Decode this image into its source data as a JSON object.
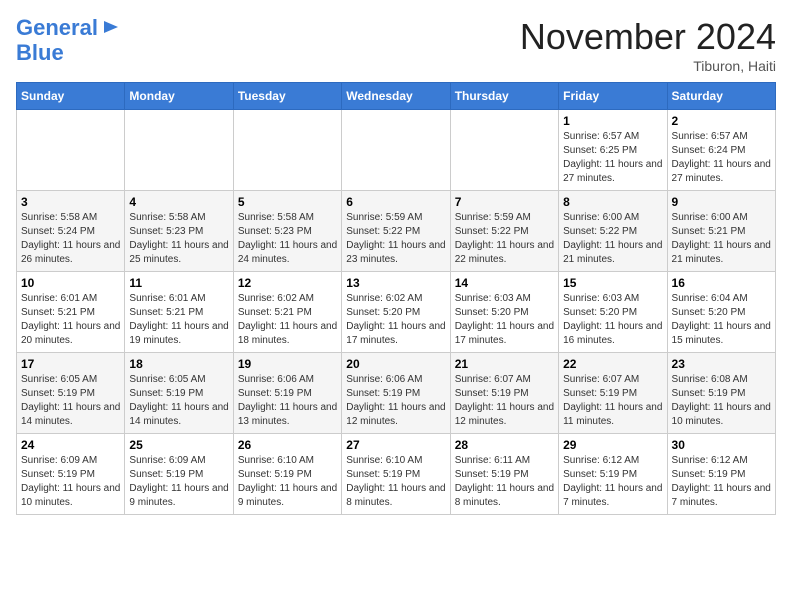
{
  "logo": {
    "line1": "General",
    "line2": "Blue"
  },
  "header": {
    "month": "November 2024",
    "location": "Tiburon, Haiti"
  },
  "weekdays": [
    "Sunday",
    "Monday",
    "Tuesday",
    "Wednesday",
    "Thursday",
    "Friday",
    "Saturday"
  ],
  "weeks": [
    [
      {
        "day": "",
        "info": ""
      },
      {
        "day": "",
        "info": ""
      },
      {
        "day": "",
        "info": ""
      },
      {
        "day": "",
        "info": ""
      },
      {
        "day": "",
        "info": ""
      },
      {
        "day": "1",
        "info": "Sunrise: 6:57 AM\nSunset: 6:25 PM\nDaylight: 11 hours and 27 minutes."
      },
      {
        "day": "2",
        "info": "Sunrise: 6:57 AM\nSunset: 6:24 PM\nDaylight: 11 hours and 27 minutes."
      }
    ],
    [
      {
        "day": "3",
        "info": "Sunrise: 5:58 AM\nSunset: 5:24 PM\nDaylight: 11 hours and 26 minutes."
      },
      {
        "day": "4",
        "info": "Sunrise: 5:58 AM\nSunset: 5:23 PM\nDaylight: 11 hours and 25 minutes."
      },
      {
        "day": "5",
        "info": "Sunrise: 5:58 AM\nSunset: 5:23 PM\nDaylight: 11 hours and 24 minutes."
      },
      {
        "day": "6",
        "info": "Sunrise: 5:59 AM\nSunset: 5:22 PM\nDaylight: 11 hours and 23 minutes."
      },
      {
        "day": "7",
        "info": "Sunrise: 5:59 AM\nSunset: 5:22 PM\nDaylight: 11 hours and 22 minutes."
      },
      {
        "day": "8",
        "info": "Sunrise: 6:00 AM\nSunset: 5:22 PM\nDaylight: 11 hours and 21 minutes."
      },
      {
        "day": "9",
        "info": "Sunrise: 6:00 AM\nSunset: 5:21 PM\nDaylight: 11 hours and 21 minutes."
      }
    ],
    [
      {
        "day": "10",
        "info": "Sunrise: 6:01 AM\nSunset: 5:21 PM\nDaylight: 11 hours and 20 minutes."
      },
      {
        "day": "11",
        "info": "Sunrise: 6:01 AM\nSunset: 5:21 PM\nDaylight: 11 hours and 19 minutes."
      },
      {
        "day": "12",
        "info": "Sunrise: 6:02 AM\nSunset: 5:21 PM\nDaylight: 11 hours and 18 minutes."
      },
      {
        "day": "13",
        "info": "Sunrise: 6:02 AM\nSunset: 5:20 PM\nDaylight: 11 hours and 17 minutes."
      },
      {
        "day": "14",
        "info": "Sunrise: 6:03 AM\nSunset: 5:20 PM\nDaylight: 11 hours and 17 minutes."
      },
      {
        "day": "15",
        "info": "Sunrise: 6:03 AM\nSunset: 5:20 PM\nDaylight: 11 hours and 16 minutes."
      },
      {
        "day": "16",
        "info": "Sunrise: 6:04 AM\nSunset: 5:20 PM\nDaylight: 11 hours and 15 minutes."
      }
    ],
    [
      {
        "day": "17",
        "info": "Sunrise: 6:05 AM\nSunset: 5:19 PM\nDaylight: 11 hours and 14 minutes."
      },
      {
        "day": "18",
        "info": "Sunrise: 6:05 AM\nSunset: 5:19 PM\nDaylight: 11 hours and 14 minutes."
      },
      {
        "day": "19",
        "info": "Sunrise: 6:06 AM\nSunset: 5:19 PM\nDaylight: 11 hours and 13 minutes."
      },
      {
        "day": "20",
        "info": "Sunrise: 6:06 AM\nSunset: 5:19 PM\nDaylight: 11 hours and 12 minutes."
      },
      {
        "day": "21",
        "info": "Sunrise: 6:07 AM\nSunset: 5:19 PM\nDaylight: 11 hours and 12 minutes."
      },
      {
        "day": "22",
        "info": "Sunrise: 6:07 AM\nSunset: 5:19 PM\nDaylight: 11 hours and 11 minutes."
      },
      {
        "day": "23",
        "info": "Sunrise: 6:08 AM\nSunset: 5:19 PM\nDaylight: 11 hours and 10 minutes."
      }
    ],
    [
      {
        "day": "24",
        "info": "Sunrise: 6:09 AM\nSunset: 5:19 PM\nDaylight: 11 hours and 10 minutes."
      },
      {
        "day": "25",
        "info": "Sunrise: 6:09 AM\nSunset: 5:19 PM\nDaylight: 11 hours and 9 minutes."
      },
      {
        "day": "26",
        "info": "Sunrise: 6:10 AM\nSunset: 5:19 PM\nDaylight: 11 hours and 9 minutes."
      },
      {
        "day": "27",
        "info": "Sunrise: 6:10 AM\nSunset: 5:19 PM\nDaylight: 11 hours and 8 minutes."
      },
      {
        "day": "28",
        "info": "Sunrise: 6:11 AM\nSunset: 5:19 PM\nDaylight: 11 hours and 8 minutes."
      },
      {
        "day": "29",
        "info": "Sunrise: 6:12 AM\nSunset: 5:19 PM\nDaylight: 11 hours and 7 minutes."
      },
      {
        "day": "30",
        "info": "Sunrise: 6:12 AM\nSunset: 5:19 PM\nDaylight: 11 hours and 7 minutes."
      }
    ]
  ]
}
